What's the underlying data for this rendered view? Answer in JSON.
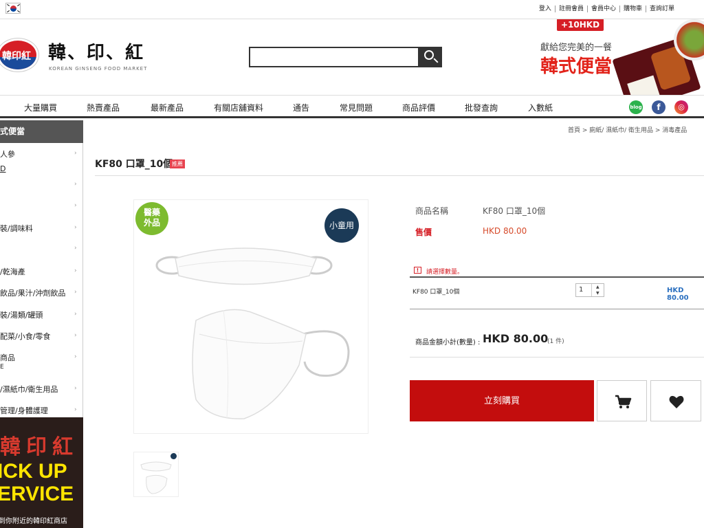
{
  "top_links": [
    "登入",
    "註冊會員",
    "會員中心",
    "購物車",
    "查詢訂單"
  ],
  "logo": {
    "badge_text": "韓印紅",
    "name": "韓、印、紅",
    "tagline": "KOREAN GINSENG FOOD MARKET"
  },
  "search": {
    "placeholder": ""
  },
  "promo": {
    "badge": "+10HKD",
    "line1": "獻給您完美的一餐",
    "line2": "韓式便當"
  },
  "nav": [
    "大量購買",
    "熱賣產品",
    "最新產品",
    "有關店舖資料",
    "通告",
    "常見問題",
    "商品評價",
    "批發查詢",
    "入數紙"
  ],
  "social": [
    "blog",
    "f",
    "◎"
  ],
  "sidebar": {
    "header": "式便當",
    "items": [
      "人參",
      "D",
      "",
      "",
      "裝/調味料",
      "",
      "/乾海產",
      "飲品/果汁/沖劑飲品",
      "裝/湯類/罐頭",
      "配菜/小食/零食",
      "商品",
      "E",
      "/濕紙巾/衛生用品",
      "管理/身體護理"
    ],
    "pickup": {
      "sign": "韓印紅",
      "line1": "ICK UP",
      "line2": "ERVICE",
      "caption": "到你附近的韓印紅商店"
    }
  },
  "breadcrumb": "首頁  >  廁紙/ 濕紙巾/ 衛生用品  >  消毒產品",
  "product": {
    "title": "KF80 口罩_10個",
    "badge": "推薦",
    "image_tags": {
      "left": "醫藥\n外品",
      "right": "小童用"
    },
    "name_label": "商品名稱",
    "name_value": "KF80 口罩_10個",
    "price_label": "售價",
    "price_value": "HKD 80.00",
    "warning": "請選擇數量。",
    "option_name": "KF80 口罩_10個",
    "quantity": "1",
    "option_price": "HKD 80.00",
    "total_label": "商品金額小計(數量) :",
    "total_value": "HKD 80.00",
    "total_qty": "(1 件)",
    "buy_label": "立刻購買"
  },
  "colors": {
    "brand_red": "#c30d0d",
    "accent_blue": "#2a6fbf",
    "green_tag": "#7dbb2f",
    "navy_tag": "#1b3a57"
  }
}
